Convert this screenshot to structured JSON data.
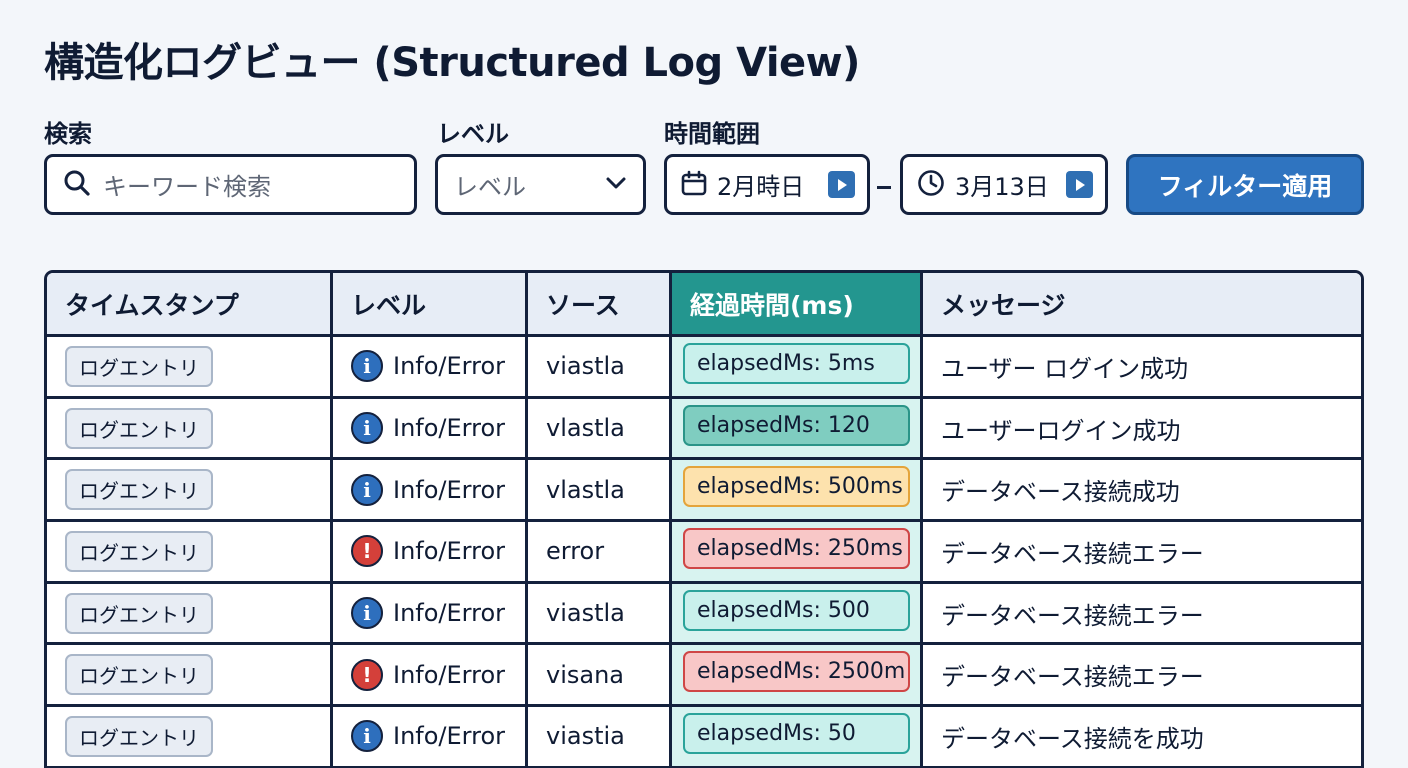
{
  "page_title": "構造化ログビュー (Structured Log View)",
  "filters": {
    "search_label": "検索",
    "search_placeholder": "キーワード検索",
    "level_label": "レベル",
    "level_placeholder": "レベル",
    "time_range_label": "時間範囲",
    "date_from": "2月時日",
    "date_separator": "-",
    "date_to": "3月13日",
    "apply_button": "フィルター適用"
  },
  "table": {
    "headers": {
      "timestamp": "タイムスタンプ",
      "level": "レベル",
      "source": "ソース",
      "elapsed": "経過時間(ms)",
      "message": "メッセージ"
    },
    "rows": [
      {
        "timestamp": "ログエントリ",
        "level": "Info/Error",
        "level_icon": "info",
        "source": "viastla",
        "elapsed": "elapsedMs: 5ms",
        "elapsed_color": "light-teal",
        "message": "ユーザー ログイン成功"
      },
      {
        "timestamp": "ログエントリ",
        "level": "Info/Error",
        "level_icon": "info",
        "source": "vlastla",
        "elapsed": "elapsedMs: 120",
        "elapsed_color": "teal",
        "message": "ユーザーログイン成功"
      },
      {
        "timestamp": "ログエントリ",
        "level": "Info/Error",
        "level_icon": "info",
        "source": "vlastla",
        "elapsed": "elapsedMs: 500ms",
        "elapsed_color": "orange",
        "message": "データベース接続成功"
      },
      {
        "timestamp": "ログエントリ",
        "level": "Info/Error",
        "level_icon": "error",
        "source": "error",
        "elapsed": "elapsedMs: 250ms",
        "elapsed_color": "red",
        "message": "データベース接続エラー"
      },
      {
        "timestamp": "ログエントリ",
        "level": "Info/Error",
        "level_icon": "info",
        "source": "viastla",
        "elapsed": "elapsedMs: 500",
        "elapsed_color": "light-teal",
        "message": "データベース接続エラー"
      },
      {
        "timestamp": "ログエントリ",
        "level": "Info/Error",
        "level_icon": "error",
        "source": "visana",
        "elapsed": "elapsedMs: 2500m",
        "elapsed_color": "red",
        "message": "データベース接続エラー"
      },
      {
        "timestamp": "ログエントリ",
        "level": "Info/Error",
        "level_icon": "info",
        "source": "viastia",
        "elapsed": "elapsedMs: 50",
        "elapsed_color": "light-teal",
        "message": "データベース接続を成功"
      }
    ]
  },
  "colors": {
    "primary_button": "#2f74c0",
    "elapsed_header": "#23968f",
    "info_icon": "#2e6fbd",
    "error_icon": "#d4403a"
  }
}
